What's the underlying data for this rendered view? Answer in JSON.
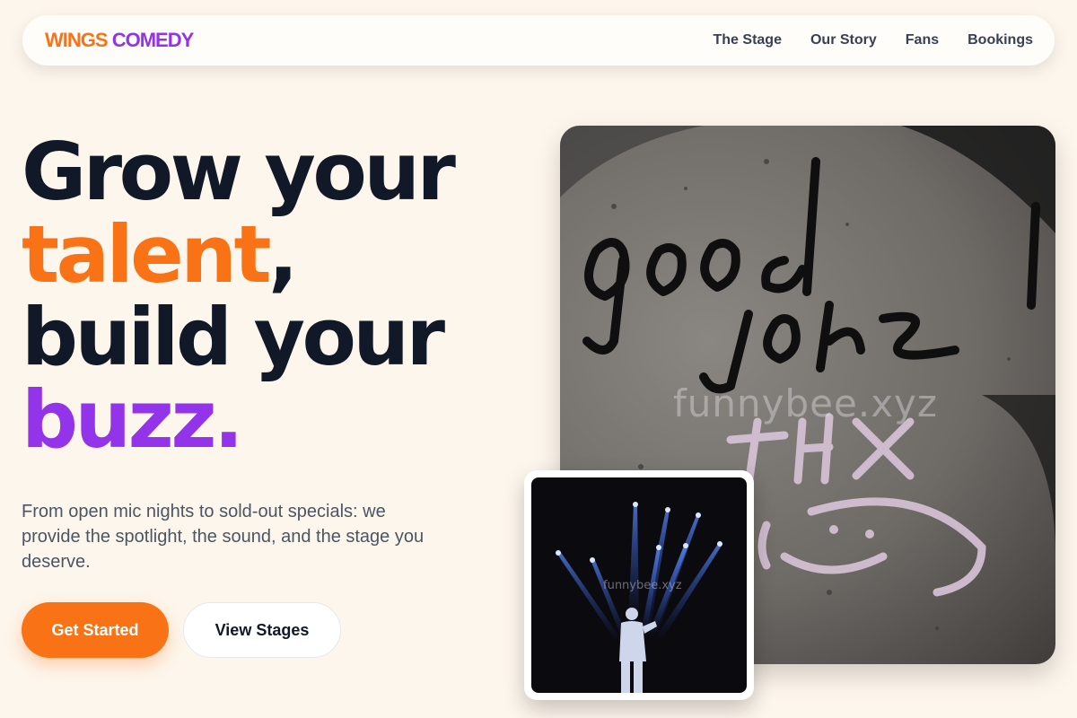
{
  "brand": {
    "part1": "WINGS",
    "part2": "COMEDY"
  },
  "nav": {
    "links": [
      "The Stage",
      "Our Story",
      "Fans",
      "Bookings"
    ]
  },
  "hero": {
    "line1": "Grow your",
    "line2_highlight": "talent",
    "line2_rest": ",",
    "line3": "build your",
    "line4_highlight": "buzz",
    "line4_rest": ".",
    "subtext": "From open mic nights to sold-out specials: we provide the spotlight, the sound, and the stage you deserve.",
    "primary_cta": "Get Started",
    "secondary_cta": "View Stages"
  },
  "images": {
    "main_watermark": "funnybee.xyz",
    "inset_watermark": "funnybee.xyz"
  },
  "colors": {
    "accent_orange": "#f97316",
    "accent_purple": "#9333ea",
    "background": "#fdf6ec",
    "heading": "#111827"
  }
}
